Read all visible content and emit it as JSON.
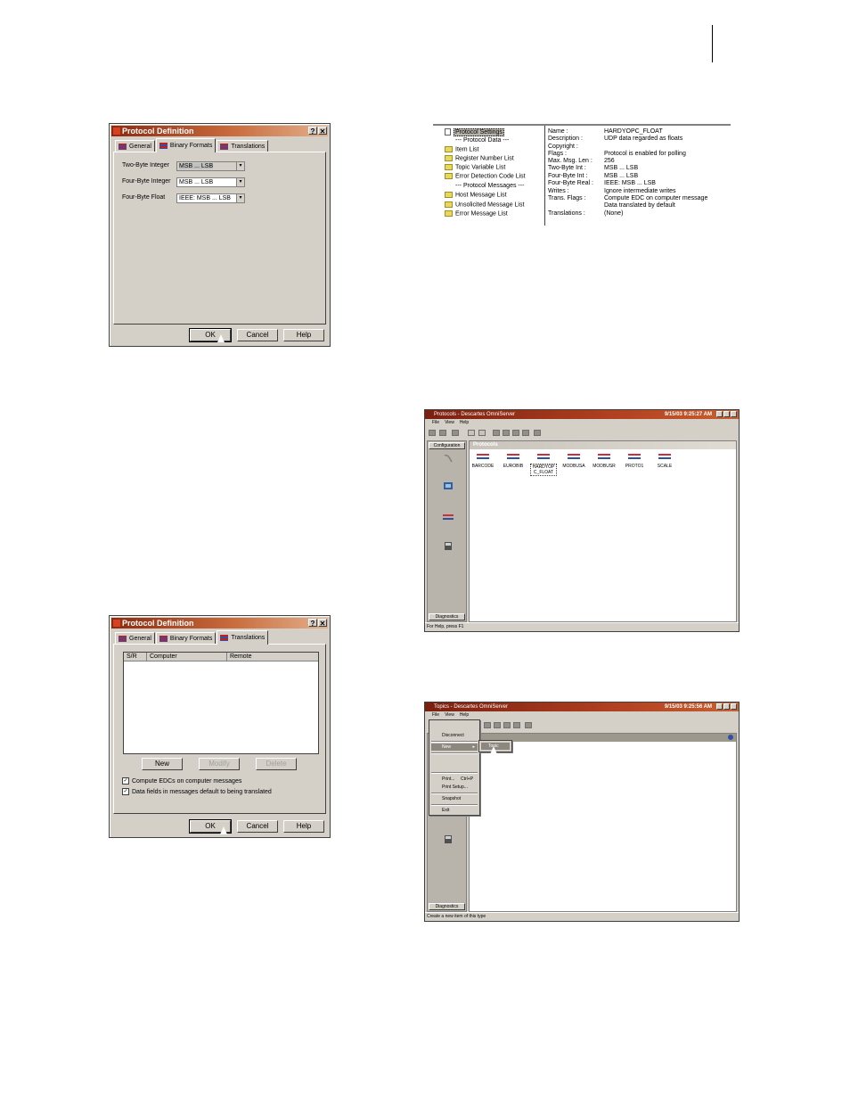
{
  "dialog_binary": {
    "title": "Protocol Definition",
    "help_btn": "?",
    "close_btn": "✕",
    "tabs": [
      "General",
      "Binary Formats",
      "Translations"
    ],
    "fields": [
      {
        "label": "Two-Byte Integer",
        "value": "MSB ... LSB"
      },
      {
        "label": "Four-Byte Integer",
        "value": "MSB ... LSB"
      },
      {
        "label": "Four-Byte Float",
        "value": "IEEE: MSB ... LSB"
      }
    ],
    "buttons": {
      "ok": "OK",
      "cancel": "Cancel",
      "help": "Help"
    }
  },
  "tree": {
    "items": [
      "Protocol Settings",
      "--- Protocol Data ---",
      "Item List",
      "Register Number List",
      "Topic Variable List",
      "Error Detection Code List",
      "--- Protocol Messages ---",
      "Host Message List",
      "Unsolicited Message List",
      "Error Message List"
    ],
    "props": [
      {
        "k": "Name :",
        "v": "HARDYOPC_FLOAT"
      },
      {
        "k": "Description :",
        "v": "UDP data regarded as floats"
      },
      {
        "k": "Copyright :",
        "v": ""
      },
      {
        "k": "Flags :",
        "v": "Protocol is enabled for polling"
      },
      {
        "k": "Max. Msg. Len :",
        "v": "256"
      },
      {
        "k": "Two-Byte Int :",
        "v": "MSB ... LSB"
      },
      {
        "k": "Four-Byte Int :",
        "v": "MSB ... LSB"
      },
      {
        "k": "Four-Byte Real :",
        "v": "IEEE: MSB ... LSB"
      },
      {
        "k": "Writes :",
        "v": "Ignore intermediate writes"
      },
      {
        "k": "Trans. Flags :",
        "v": "Compute EDC on computer message"
      },
      {
        "k": "",
        "v": "Data translated by default"
      },
      {
        "k": "Translations :",
        "v": "(None)"
      }
    ]
  },
  "protocols_window": {
    "title": "Protocols - Descartes OmniServer",
    "time": "9/15/03 9:25:27 AM",
    "menus": [
      "File",
      "View",
      "Help"
    ],
    "sidebar_top": "Configuration",
    "sidebar_bottom": "Diagnostics",
    "pane_title": "Protocols",
    "protocols": [
      "BARCODE",
      "EUROBIB",
      "HARDYOPC_FLOAT",
      "MODBUSA",
      "MODBUSR",
      "PROTO1",
      "SCALE"
    ],
    "status": "For Help, press F1"
  },
  "dialog_translations": {
    "title": "Protocol Definition",
    "help_btn": "?",
    "close_btn": "✕",
    "tabs": [
      "General",
      "Binary Formats",
      "Translations"
    ],
    "columns": [
      "S/R",
      "Computer",
      "Remote"
    ],
    "list_buttons": {
      "new": "New",
      "modify": "Modify",
      "delete": "Delete"
    },
    "checks": [
      "Compute EDCs on computer messages",
      "Data fields in messages default to being translated"
    ],
    "buttons": {
      "ok": "OK",
      "cancel": "Cancel",
      "help": "Help"
    }
  },
  "topics_window": {
    "title": "Topics - Descartes OmniServer",
    "time": "9/15/03 9:25:56 AM",
    "menus": [
      "File",
      "View",
      "Help"
    ],
    "file_menu": [
      "Disconnect",
      "New",
      "Print...",
      "Print Setup...",
      "Snapshot",
      "Exit"
    ],
    "print_shortcut": "Ctrl+P",
    "submenu": "Topic",
    "sidebar_bottom": "Diagnostics",
    "status": "Create a new item of this type"
  }
}
